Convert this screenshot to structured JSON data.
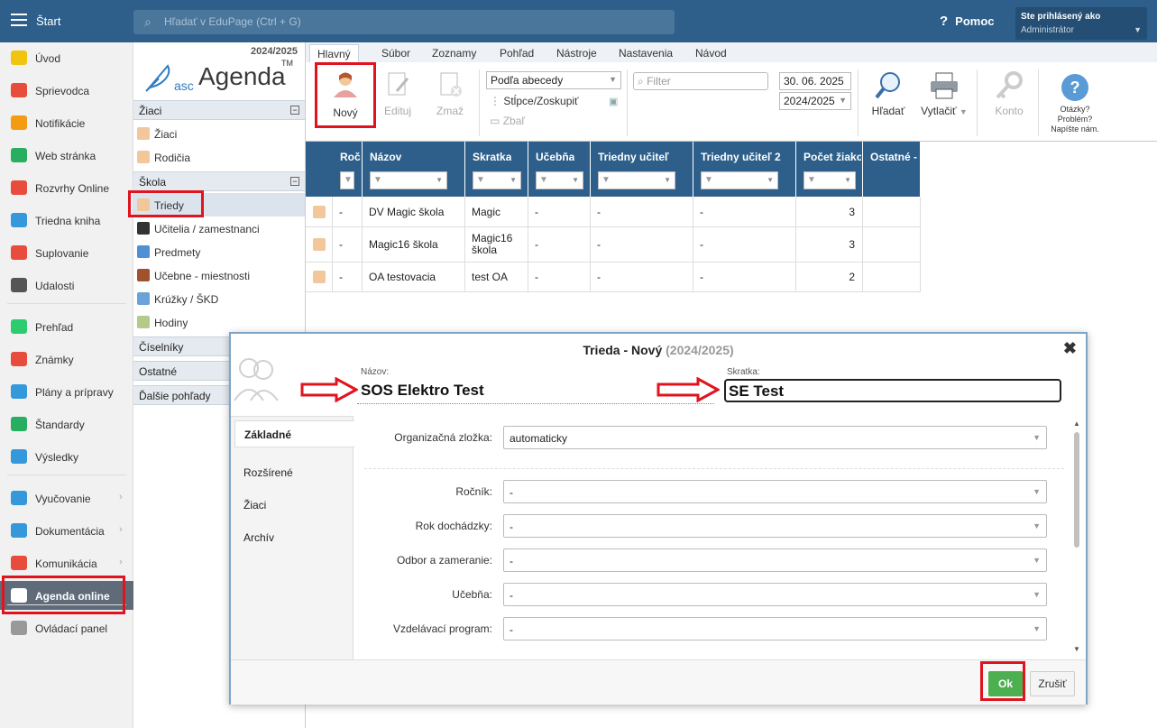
{
  "topbar": {
    "menu_label": "Štart",
    "search_placeholder": "Hľadať v EduPage (Ctrl + G)",
    "help_label": "Pomoc",
    "user_line1": "Ste prihlásený ako",
    "user_line2": "Administrátor"
  },
  "sidebar": {
    "items": [
      {
        "label": "Úvod",
        "icon": "star-icon",
        "color": "#f1c40f"
      },
      {
        "label": "Sprievodca",
        "icon": "wand-icon",
        "color": "#e74c3c"
      },
      {
        "label": "Notifikácie",
        "icon": "envelope-icon",
        "color": "#f39c12"
      },
      {
        "label": "Web stránka",
        "icon": "home-icon",
        "color": "#27ae60"
      },
      {
        "label": "Rozvrhy Online",
        "icon": "calendar-grid-icon",
        "color": "#e74c3c"
      },
      {
        "label": "Triedna kniha",
        "icon": "book-icon",
        "color": "#3498db"
      },
      {
        "label": "Suplovanie",
        "icon": "person-icon",
        "color": "#e74c3c"
      },
      {
        "label": "Udalosti",
        "icon": "calendar-icon",
        "color": "#555555"
      },
      {
        "label": "Prehľad",
        "icon": "check-circle-icon",
        "color": "#2ecc71"
      },
      {
        "label": "Známky",
        "icon": "grade-icon",
        "color": "#e74c3c"
      },
      {
        "label": "Plány a prípravy",
        "icon": "briefcase-icon",
        "color": "#3498db"
      },
      {
        "label": "Štandardy",
        "icon": "shield-check-icon",
        "color": "#27ae60"
      },
      {
        "label": "Výsledky",
        "icon": "bar-chart-icon",
        "color": "#3498db"
      },
      {
        "label": "Vyučovanie",
        "icon": "open-book-icon",
        "color": "#3498db"
      },
      {
        "label": "Dokumentácia",
        "icon": "folder-icon",
        "color": "#3498db"
      },
      {
        "label": "Komunikácia",
        "icon": "chat-icon",
        "color": "#e74c3c"
      },
      {
        "label": "Agenda online",
        "icon": "feather-icon",
        "color": "#ffffff"
      },
      {
        "label": "Ovládací panel",
        "icon": "gear-icon",
        "color": "#999999"
      }
    ]
  },
  "app": {
    "year": "2024/2025",
    "logo_asc": "asc",
    "logo_agenda": "Agenda",
    "logo_tm": "TM",
    "sections": {
      "ziaci": "Žiaci",
      "skola": "Škola",
      "ciselniky": "Číselníky",
      "ostatne": "Ostatné",
      "dalsie": "Ďalšie pohľady"
    },
    "ziaci_items": [
      "Žiaci",
      "Rodičia"
    ],
    "skola_items": [
      "Triedy",
      "Učitelia / zamestnanci",
      "Predmety",
      "Učebne - miestnosti",
      "Krúžky / ŠKD",
      "Hodiny"
    ]
  },
  "tabs": [
    "Hlavný",
    "Súbor",
    "Zoznamy",
    "Pohľad",
    "Nástroje",
    "Nastavenia",
    "Návod"
  ],
  "ribbon": {
    "new": "Nový",
    "edit": "Edituj",
    "delete": "Zmaž",
    "sort": "Podľa abecedy",
    "columns": "Stĺpce/Zoskupiť",
    "collapse": "Zbaľ",
    "filter_placeholder": "Filter",
    "date": "30. 06. 2025",
    "year": "2024/2025",
    "find": "Hľadať",
    "print": "Vytlačiť",
    "account": "Konto",
    "q1": "Otázky?",
    "q2": "Problém?",
    "q3": "Napíšte nám."
  },
  "grid": {
    "headers": [
      "Ročník",
      "Názov",
      "Skratka",
      "Učebňa",
      "Triedny učiteľ",
      "Triedny učiteľ 2",
      "Počet žiakov",
      "Ostatné -"
    ],
    "rows": [
      {
        "rocnik": "-",
        "nazov": "DV Magic škola",
        "skratka": "Magic",
        "ucebna": "-",
        "tu1": "-",
        "tu2": "-",
        "pocet": "3"
      },
      {
        "rocnik": "-",
        "nazov": "Magic16 škola",
        "skratka": "Magic16 škola",
        "ucebna": "-",
        "tu1": "-",
        "tu2": "-",
        "pocet": "3"
      },
      {
        "rocnik": "-",
        "nazov": "OA testovacia",
        "skratka": "test OA",
        "ucebna": "-",
        "tu1": "-",
        "tu2": "-",
        "pocet": "2"
      }
    ]
  },
  "dialog": {
    "title": "Trieda - Nový",
    "title_year": "(2024/2025)",
    "name_label": "Názov:",
    "name_value": "SOS Elektro Test",
    "abbr_label": "Skratka:",
    "abbr_value": "SE Test",
    "tabs": [
      "Základné",
      "Rozšírené",
      "Žiaci",
      "Archív"
    ],
    "fields": [
      {
        "label": "Organizačná zložka:",
        "value": "automaticky"
      },
      {
        "label": "Ročník:",
        "value": "-"
      },
      {
        "label": "Rok dochádzky:",
        "value": "-"
      },
      {
        "label": "Odbor a zameranie:",
        "value": "-"
      },
      {
        "label": "Učebňa:",
        "value": "-"
      },
      {
        "label": "Vzdelávací program:",
        "value": "-"
      }
    ],
    "ok": "Ok",
    "cancel": "Zrušiť"
  },
  "colors": {
    "topbar": "#2d5f8a",
    "highlight": "#e0141e",
    "ok": "#4caf50",
    "active_nav": "#5f6b79"
  }
}
